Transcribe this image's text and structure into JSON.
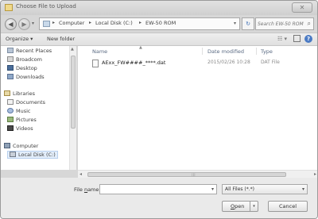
{
  "window": {
    "title": "Choose File to Upload",
    "close_label": "✕"
  },
  "navbar": {
    "back_icon": "◀",
    "forward_icon": "▶",
    "breadcrumbs": [
      "Computer",
      "Local Disk (C:)",
      "EW-50 ROM"
    ],
    "separator": "▸",
    "refresh_icon": "↻",
    "search_placeholder": "Search EW-50 ROM"
  },
  "toolbar": {
    "organize_label": "Organize ▾",
    "new_folder_label": "New folder"
  },
  "sidebar": {
    "favorites": [
      {
        "label": "Recent Places",
        "icon": "recent-places-icon"
      },
      {
        "label": "Broadcom",
        "icon": "folder-icon"
      },
      {
        "label": "Desktop",
        "icon": "desktop-icon"
      },
      {
        "label": "Downloads",
        "icon": "downloads-icon"
      }
    ],
    "libraries_label": "Libraries",
    "libraries": [
      {
        "label": "Documents",
        "icon": "documents-icon"
      },
      {
        "label": "Music",
        "icon": "music-icon"
      },
      {
        "label": "Pictures",
        "icon": "pictures-icon"
      },
      {
        "label": "Videos",
        "icon": "videos-icon"
      }
    ],
    "computer_label": "Computer",
    "computer_items": [
      {
        "label": "Local Disk (C:)",
        "icon": "local-disk-icon"
      }
    ]
  },
  "file_list": {
    "columns": {
      "name": "Name",
      "date": "Date modified",
      "type": "Type"
    },
    "files": [
      {
        "name": "AExx_FW####_****.dat",
        "date": "2015/02/26 10:28",
        "type": "DAT File"
      }
    ]
  },
  "bottom": {
    "file_name_label_pre": "File ",
    "file_name_label_u": "n",
    "file_name_label_post": "ame:",
    "file_name_value": "",
    "filter_value": "All Files (*.*)",
    "open_label_u": "O",
    "open_label_rest": "pen",
    "cancel_label": "Cancel"
  }
}
